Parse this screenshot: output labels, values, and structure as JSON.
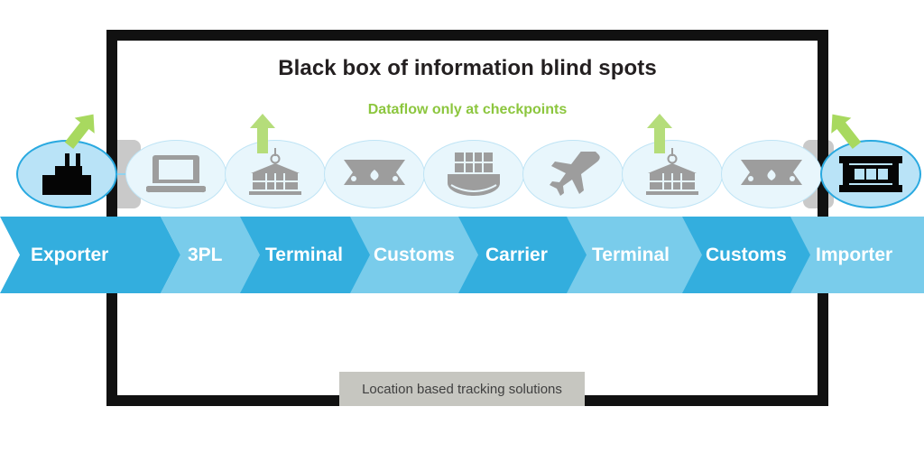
{
  "headings": {
    "title": "Black box of information blind spots",
    "subtitle": "Dataflow only at checkpoints"
  },
  "footer_label": {
    "text": "Location based tracking solutions"
  },
  "colors": {
    "chevron_dark": "#33aede",
    "chevron_light": "#79cceb",
    "green_accent": "#8cc63e",
    "black_frame": "#111111",
    "gray_label_bg": "#c6c6c0",
    "node_active_fill": "#b9e3f7",
    "node_active_stroke": "#29a9e0",
    "node_inactive_fill": "#e8f6fc",
    "node_inactive_stroke": "#bfe4f5",
    "icon_inactive": "#9d9d9d",
    "icon_active": "#050505"
  },
  "nodes": [
    {
      "icon": "factory-icon",
      "state": "active",
      "label": "Exporter"
    },
    {
      "icon": "laptop-icon",
      "state": "inactive",
      "label": "3PL"
    },
    {
      "icon": "crane-container-icon",
      "state": "inactive",
      "label": "Terminal"
    },
    {
      "icon": "customs-building-icon",
      "state": "inactive",
      "label": "Customs"
    },
    {
      "icon": "container-ship-icon",
      "state": "inactive",
      "label": "Carrier"
    },
    {
      "icon": "airplane-icon",
      "state": "inactive",
      "label": "Terminal"
    },
    {
      "icon": "crane-container-icon",
      "state": "inactive",
      "label": "Terminal"
    },
    {
      "icon": "customs-building-icon",
      "state": "inactive",
      "label": "Customs"
    },
    {
      "icon": "warehouse-icon",
      "state": "active",
      "label": "Importer"
    }
  ],
  "chevrons": [
    {
      "label": "Exporter",
      "tone": "dark"
    },
    {
      "label": "3PL",
      "tone": "light"
    },
    {
      "label": "Terminal",
      "tone": "dark"
    },
    {
      "label": "Customs",
      "tone": "light"
    },
    {
      "label": "Carrier",
      "tone": "dark"
    },
    {
      "label": "Terminal",
      "tone": "light"
    },
    {
      "label": "Customs",
      "tone": "dark"
    },
    {
      "label": "Importer",
      "tone": "light"
    }
  ],
  "dataflow_arrows": [
    {
      "name": "dataflow-arrow-exporter",
      "direction": "up-right"
    },
    {
      "name": "dataflow-arrow-terminal-1",
      "direction": "up"
    },
    {
      "name": "dataflow-arrow-terminal-2",
      "direction": "up"
    },
    {
      "name": "dataflow-arrow-importer",
      "direction": "up-left"
    }
  ]
}
